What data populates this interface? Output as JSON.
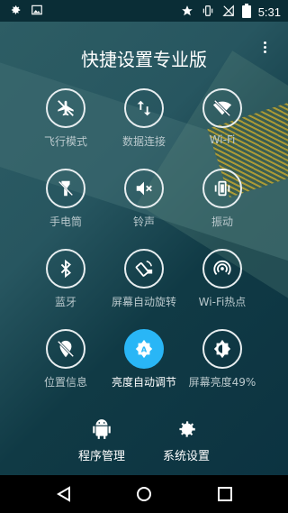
{
  "status": {
    "time": "5:31",
    "icons": [
      "gear-icon",
      "image-icon",
      "star-icon",
      "vibrate-icon",
      "no-signal-icon",
      "battery-icon"
    ]
  },
  "app": {
    "title": "快捷设置专业版",
    "menu_icon": "more-vert-icon"
  },
  "tiles": [
    {
      "label": "飞行模式",
      "icon": "airplane-off-icon",
      "active": false
    },
    {
      "label": "数据连接",
      "icon": "data-arrows-icon",
      "active": false
    },
    {
      "label": "Wi-Fi",
      "icon": "wifi-off-icon",
      "active": false
    },
    {
      "label": "手电筒",
      "icon": "flashlight-icon",
      "active": false
    },
    {
      "label": "铃声",
      "icon": "volume-off-icon",
      "active": false
    },
    {
      "label": "振动",
      "icon": "vibrate-icon",
      "active": false
    },
    {
      "label": "蓝牙",
      "icon": "bluetooth-icon",
      "active": false
    },
    {
      "label": "屏幕自动旋转",
      "icon": "screen-rotation-icon",
      "active": false
    },
    {
      "label": "Wi-Fi热点",
      "icon": "wifi-tethering-icon",
      "active": false
    },
    {
      "label": "位置信息",
      "icon": "location-off-icon",
      "active": false
    },
    {
      "label": "亮度自动调节",
      "icon": "brightness-auto-icon",
      "active": true
    },
    {
      "label": "屏幕亮度49%",
      "icon": "brightness-half-icon",
      "active": false
    }
  ],
  "bottom": {
    "apps": {
      "label": "程序管理",
      "icon": "android-icon"
    },
    "settings": {
      "label": "系统设置",
      "icon": "gear-icon"
    }
  },
  "nav": [
    "back-icon",
    "home-icon",
    "recents-icon"
  ],
  "colors": {
    "accent": "#29b6f6",
    "background": "#0b3340"
  }
}
